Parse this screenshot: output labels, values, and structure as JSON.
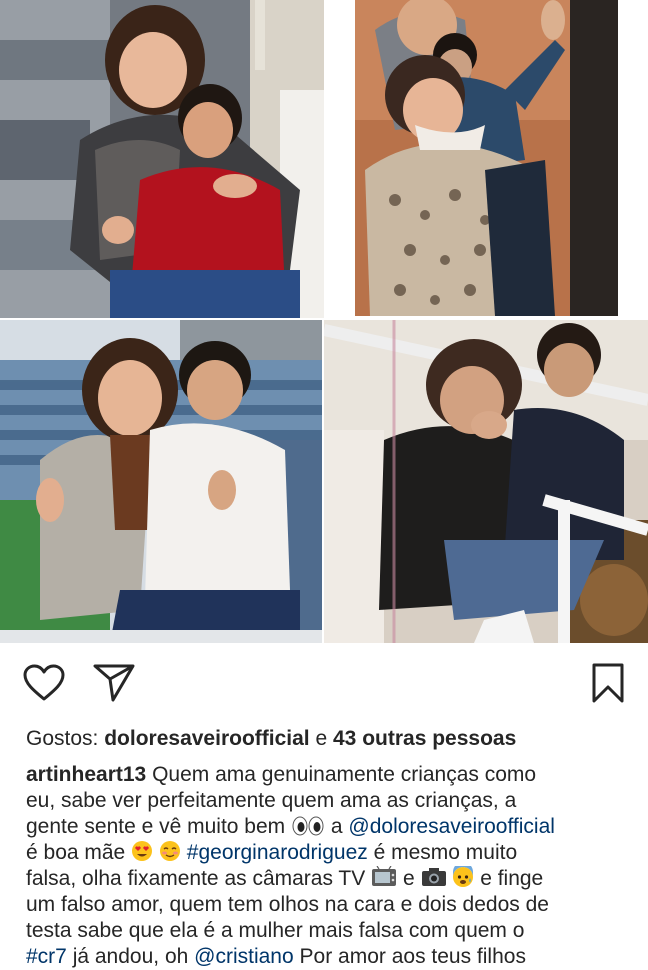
{
  "post": {
    "photos": [
      {
        "alt": "Mulher e criança sentadas num camarote de estádio"
      },
      {
        "alt": "Mulher com casaco de leopardo e criança a acenar"
      },
      {
        "alt": "Mulher e criança de camisa branca no estádio"
      },
      {
        "alt": "Mulher emocionada e criança na bancada"
      }
    ],
    "actions": {
      "like_icon": "heart-outline-icon",
      "share_icon": "paper-plane-icon",
      "save_icon": "bookmark-outline-icon"
    },
    "likes": {
      "prefix": "Gostos:",
      "user": "doloresaveiroofficial",
      "connector": "e",
      "others": "43 outras pessoas"
    },
    "caption": {
      "username": "artinheart13",
      "line1": "Quem ama genuinamente crianças como",
      "line2": "eu, sabe ver perfeitamente quem ama as crianças, a",
      "line3a": "gente sente e vê muito bem",
      "line3b": "a",
      "line3_mention": "@doloresaveiroofficial",
      "line4a": "é boa mãe",
      "line4_hashtag": "#georginarodriguez",
      "line4b": "é mesmo muito",
      "line5a": "falsa, olha fixamente as câmaras TV",
      "line5b": "e",
      "line5c": "e finge",
      "line6": "um falso amor, quem tem olhos na cara e dois dedos de",
      "line7": "testa sabe que ela é a mulher mais falsa com quem o",
      "line8_hashtag": "#cr7",
      "line8a": "já andou, oh",
      "line8_mention": "@cristiano",
      "line8b": "Por amor aos teus filhos"
    },
    "emoji": [
      "eyes",
      "heart-eyes",
      "smiling-blush",
      "television",
      "camera",
      "anxious-face"
    ]
  }
}
